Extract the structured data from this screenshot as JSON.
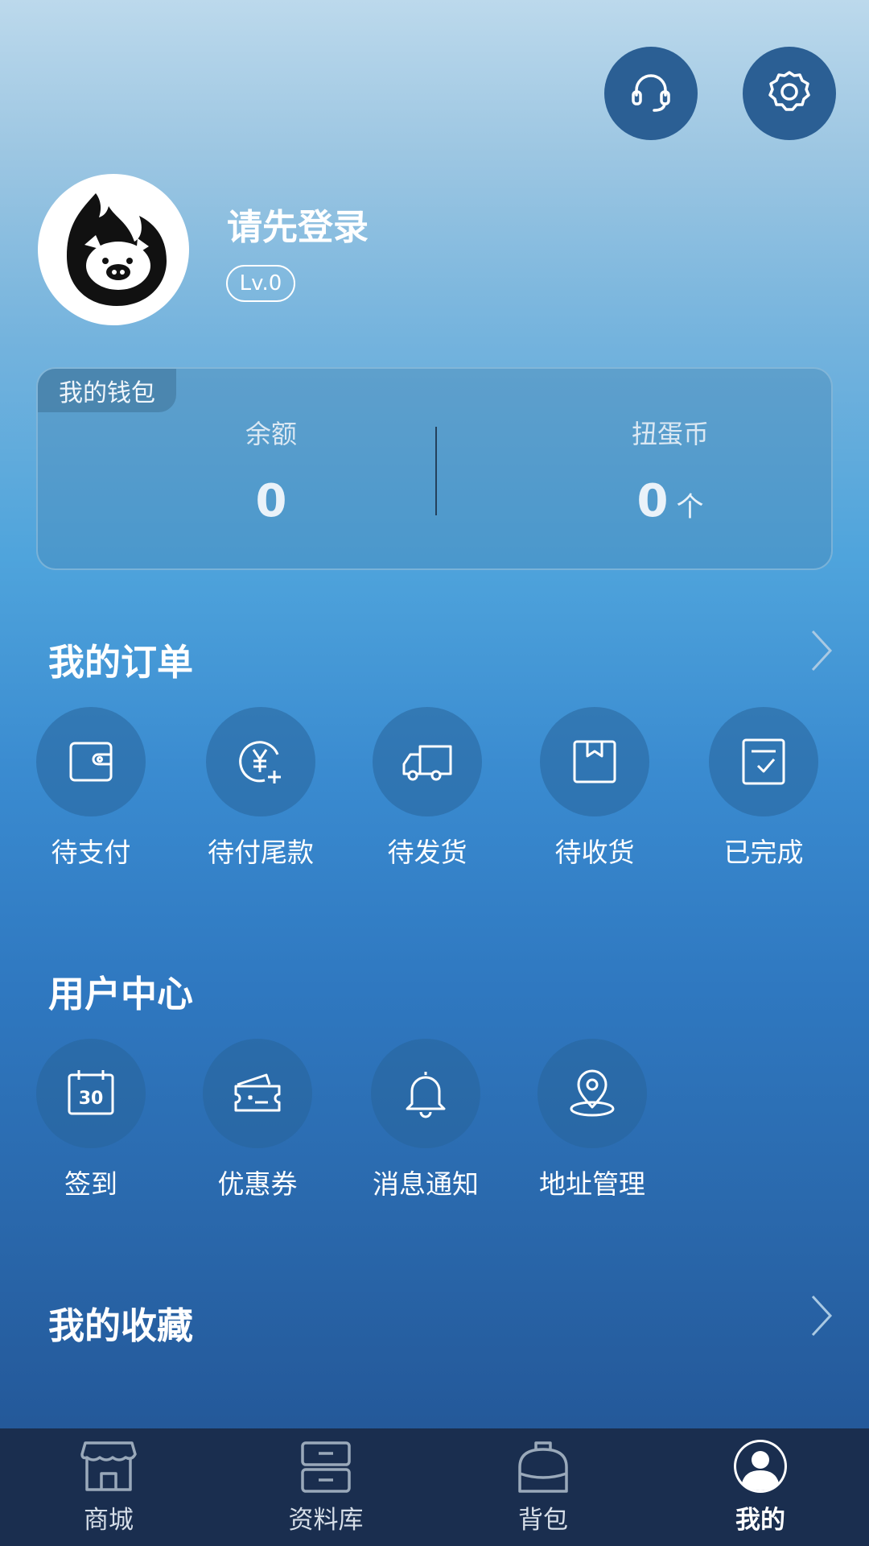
{
  "header": {
    "support_icon": "headset-icon",
    "settings_icon": "gear-icon"
  },
  "profile": {
    "username": "请先登录",
    "level": "Lv.0"
  },
  "wallet": {
    "tag": "我的钱包",
    "balance_label": "余额",
    "balance_value": "0",
    "coin_label": "扭蛋币",
    "coin_value": "0",
    "coin_unit": "个"
  },
  "orders": {
    "title": "我的订单",
    "items": [
      {
        "label": "待支付",
        "icon": "wallet-icon"
      },
      {
        "label": "待付尾款",
        "icon": "yuan-plus-icon"
      },
      {
        "label": "待发货",
        "icon": "truck-icon"
      },
      {
        "label": "待收货",
        "icon": "box-icon"
      },
      {
        "label": "已完成",
        "icon": "checklist-icon"
      }
    ]
  },
  "user_center": {
    "title": "用户中心",
    "items": [
      {
        "label": "签到",
        "icon": "calendar-icon",
        "icon_text": "30"
      },
      {
        "label": "优惠券",
        "icon": "coupon-icon"
      },
      {
        "label": "消息通知",
        "icon": "bell-icon"
      },
      {
        "label": "地址管理",
        "icon": "location-icon"
      }
    ]
  },
  "favorites": {
    "title": "我的收藏"
  },
  "bottom_nav": {
    "items": [
      {
        "label": "商城",
        "icon": "store-icon"
      },
      {
        "label": "资料库",
        "icon": "database-icon"
      },
      {
        "label": "背包",
        "icon": "backpack-icon"
      },
      {
        "label": "我的",
        "icon": "user-icon",
        "active": true
      }
    ]
  }
}
